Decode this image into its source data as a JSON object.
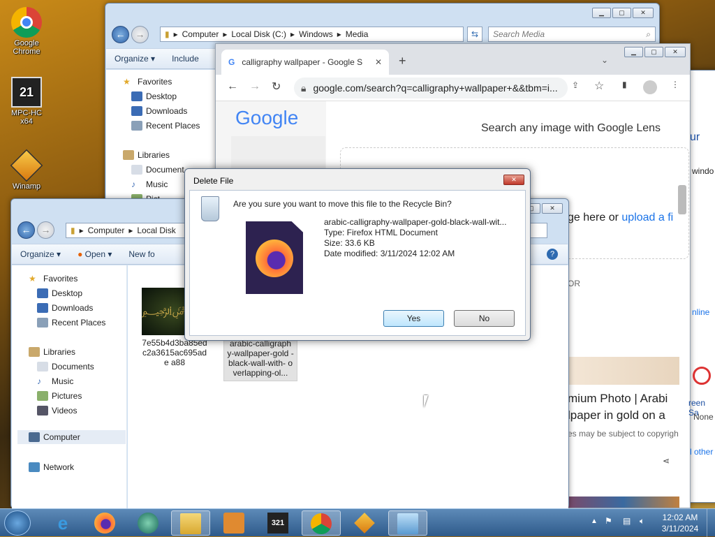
{
  "desktop": {
    "icons": [
      {
        "label": "Google Chrome",
        "icon": "chrome-icon"
      },
      {
        "label": "MPC-HC x64",
        "icon": "mpc-hc-icon"
      },
      {
        "label": "Winamp",
        "icon": "winamp-icon"
      }
    ]
  },
  "explorer_back": {
    "address": [
      "Computer",
      "Local Disk (C:)",
      "Windows",
      "Media"
    ],
    "search_placeholder": "Search Media",
    "toolbar": {
      "organize": "Organize ▾",
      "include": "Include"
    },
    "nav": {
      "favorites": "Favorites",
      "desktop": "Desktop",
      "downloads": "Downloads",
      "recent": "Recent Places",
      "libraries": "Libraries",
      "documents": "Document",
      "music": "Music",
      "pictures": "Pict"
    }
  },
  "chrome_window": {
    "tab_title": "calligraphy wallpaper - Google S",
    "url": "google.com/search?q=calligraphy+wallpaper+&&tbm=i...",
    "logo": "Google",
    "lens_title": "Search any image with Google Lens",
    "lens_hint": "ge here or",
    "lens_link": "upload a fi",
    "or_label": "OR",
    "result_title_1": "mium Photo | Arabi",
    "result_title_2": "lpaper in gold on a",
    "result_note": "es may be subject to copyrigh",
    "side_text_1": "ur",
    "side_text_2": "windo",
    "side_text_3": "nline",
    "side_text_4": "reen Sa",
    "side_text_5": "None",
    "side_text_6": "l other"
  },
  "explorer_front": {
    "address": [
      "Computer",
      "Local Disk"
    ],
    "toolbar": {
      "organize": "Organize ▾",
      "open": "Open",
      "newfolder": "New fo"
    },
    "nav": {
      "favorites": "Favorites",
      "desktop": "Desktop",
      "downloads": "Downloads",
      "recent": "Recent Places",
      "libraries": "Libraries",
      "documents": "Documents",
      "music": "Music",
      "pictures": "Pictures",
      "videos": "Videos",
      "computer": "Computer",
      "network": "Network"
    },
    "files": [
      {
        "name": "7e55b4d3ba85ed c2a3615ac695ade a88"
      },
      {
        "name": "arabic-calligraph y-wallpaper-gold -black-wall-with- overlapping-ol..."
      }
    ]
  },
  "dialog": {
    "title": "Delete File",
    "question": "Are you sure you want to move this file to the Recycle Bin?",
    "file_name": "arabic-calligraphy-wallpaper-gold-black-wall-wit...",
    "file_type": "Type: Firefox HTML Document",
    "file_size": "Size: 33.6 KB",
    "file_date": "Date modified: 3/11/2024 12:02 AM",
    "yes": "Yes",
    "no": "No"
  },
  "taskbar": {
    "time": "12:02 AM",
    "date": "3/11/2024"
  }
}
